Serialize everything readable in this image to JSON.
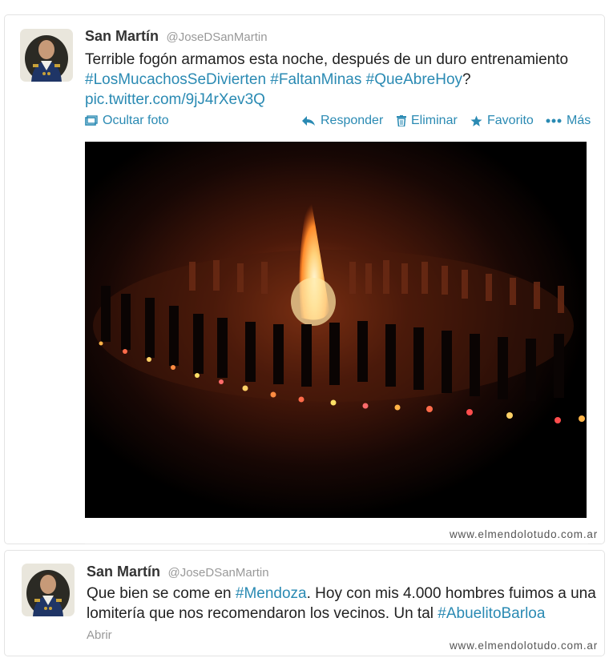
{
  "tweets": [
    {
      "author": "San Martín",
      "handle": "@JoseDSanMartin",
      "text_line1": "Terrible fogón armamos esta noche, después de un duro entrenamiento",
      "hashtags": [
        "#LosMucachosSeDivierten",
        "#FaltanMinas",
        "#QueAbreHoy"
      ],
      "after_hashtags": "?",
      "pic_link": "pic.twitter.com/9jJ4rXev3Q",
      "actions": {
        "hide_photo": "Ocultar foto",
        "reply": "Responder",
        "delete": "Eliminar",
        "favorite": "Favorito",
        "more": "Más"
      },
      "photo_description_icon": "bonfire-photo"
    },
    {
      "author": "San Martín",
      "handle": "@JoseDSanMartin",
      "text_before_tag": "Que bien se come en ",
      "tag1": "#Mendoza",
      "text_after_tag1": ". Hoy con mis 4.000 hombres fuimos a una lomitería que nos recomendaron los vecinos. Un tal ",
      "tag2": "#AbuelitoBarloa",
      "open_label": "Abrir"
    }
  ],
  "watermark": "www.elmendolotudo.com.ar",
  "colors": {
    "link": "#2a8ab3",
    "meta": "#999999",
    "text": "#222222"
  }
}
